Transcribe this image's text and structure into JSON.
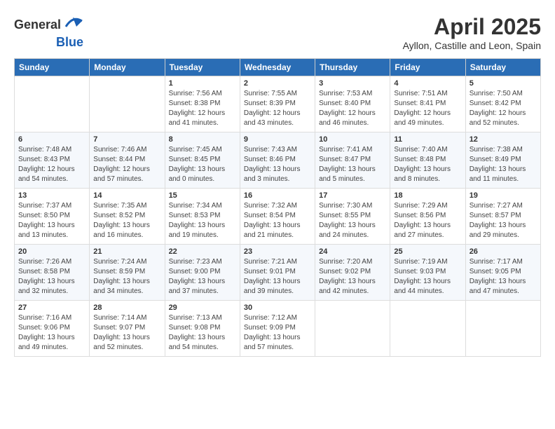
{
  "header": {
    "logo_general": "General",
    "logo_blue": "Blue",
    "month_title": "April 2025",
    "location": "Ayllon, Castille and Leon, Spain"
  },
  "calendar": {
    "days_of_week": [
      "Sunday",
      "Monday",
      "Tuesday",
      "Wednesday",
      "Thursday",
      "Friday",
      "Saturday"
    ],
    "weeks": [
      [
        {
          "day": "",
          "info": ""
        },
        {
          "day": "",
          "info": ""
        },
        {
          "day": "1",
          "info": "Sunrise: 7:56 AM\nSunset: 8:38 PM\nDaylight: 12 hours and 41 minutes."
        },
        {
          "day": "2",
          "info": "Sunrise: 7:55 AM\nSunset: 8:39 PM\nDaylight: 12 hours and 43 minutes."
        },
        {
          "day": "3",
          "info": "Sunrise: 7:53 AM\nSunset: 8:40 PM\nDaylight: 12 hours and 46 minutes."
        },
        {
          "day": "4",
          "info": "Sunrise: 7:51 AM\nSunset: 8:41 PM\nDaylight: 12 hours and 49 minutes."
        },
        {
          "day": "5",
          "info": "Sunrise: 7:50 AM\nSunset: 8:42 PM\nDaylight: 12 hours and 52 minutes."
        }
      ],
      [
        {
          "day": "6",
          "info": "Sunrise: 7:48 AM\nSunset: 8:43 PM\nDaylight: 12 hours and 54 minutes."
        },
        {
          "day": "7",
          "info": "Sunrise: 7:46 AM\nSunset: 8:44 PM\nDaylight: 12 hours and 57 minutes."
        },
        {
          "day": "8",
          "info": "Sunrise: 7:45 AM\nSunset: 8:45 PM\nDaylight: 13 hours and 0 minutes."
        },
        {
          "day": "9",
          "info": "Sunrise: 7:43 AM\nSunset: 8:46 PM\nDaylight: 13 hours and 3 minutes."
        },
        {
          "day": "10",
          "info": "Sunrise: 7:41 AM\nSunset: 8:47 PM\nDaylight: 13 hours and 5 minutes."
        },
        {
          "day": "11",
          "info": "Sunrise: 7:40 AM\nSunset: 8:48 PM\nDaylight: 13 hours and 8 minutes."
        },
        {
          "day": "12",
          "info": "Sunrise: 7:38 AM\nSunset: 8:49 PM\nDaylight: 13 hours and 11 minutes."
        }
      ],
      [
        {
          "day": "13",
          "info": "Sunrise: 7:37 AM\nSunset: 8:50 PM\nDaylight: 13 hours and 13 minutes."
        },
        {
          "day": "14",
          "info": "Sunrise: 7:35 AM\nSunset: 8:52 PM\nDaylight: 13 hours and 16 minutes."
        },
        {
          "day": "15",
          "info": "Sunrise: 7:34 AM\nSunset: 8:53 PM\nDaylight: 13 hours and 19 minutes."
        },
        {
          "day": "16",
          "info": "Sunrise: 7:32 AM\nSunset: 8:54 PM\nDaylight: 13 hours and 21 minutes."
        },
        {
          "day": "17",
          "info": "Sunrise: 7:30 AM\nSunset: 8:55 PM\nDaylight: 13 hours and 24 minutes."
        },
        {
          "day": "18",
          "info": "Sunrise: 7:29 AM\nSunset: 8:56 PM\nDaylight: 13 hours and 27 minutes."
        },
        {
          "day": "19",
          "info": "Sunrise: 7:27 AM\nSunset: 8:57 PM\nDaylight: 13 hours and 29 minutes."
        }
      ],
      [
        {
          "day": "20",
          "info": "Sunrise: 7:26 AM\nSunset: 8:58 PM\nDaylight: 13 hours and 32 minutes."
        },
        {
          "day": "21",
          "info": "Sunrise: 7:24 AM\nSunset: 8:59 PM\nDaylight: 13 hours and 34 minutes."
        },
        {
          "day": "22",
          "info": "Sunrise: 7:23 AM\nSunset: 9:00 PM\nDaylight: 13 hours and 37 minutes."
        },
        {
          "day": "23",
          "info": "Sunrise: 7:21 AM\nSunset: 9:01 PM\nDaylight: 13 hours and 39 minutes."
        },
        {
          "day": "24",
          "info": "Sunrise: 7:20 AM\nSunset: 9:02 PM\nDaylight: 13 hours and 42 minutes."
        },
        {
          "day": "25",
          "info": "Sunrise: 7:19 AM\nSunset: 9:03 PM\nDaylight: 13 hours and 44 minutes."
        },
        {
          "day": "26",
          "info": "Sunrise: 7:17 AM\nSunset: 9:05 PM\nDaylight: 13 hours and 47 minutes."
        }
      ],
      [
        {
          "day": "27",
          "info": "Sunrise: 7:16 AM\nSunset: 9:06 PM\nDaylight: 13 hours and 49 minutes."
        },
        {
          "day": "28",
          "info": "Sunrise: 7:14 AM\nSunset: 9:07 PM\nDaylight: 13 hours and 52 minutes."
        },
        {
          "day": "29",
          "info": "Sunrise: 7:13 AM\nSunset: 9:08 PM\nDaylight: 13 hours and 54 minutes."
        },
        {
          "day": "30",
          "info": "Sunrise: 7:12 AM\nSunset: 9:09 PM\nDaylight: 13 hours and 57 minutes."
        },
        {
          "day": "",
          "info": ""
        },
        {
          "day": "",
          "info": ""
        },
        {
          "day": "",
          "info": ""
        }
      ]
    ]
  }
}
